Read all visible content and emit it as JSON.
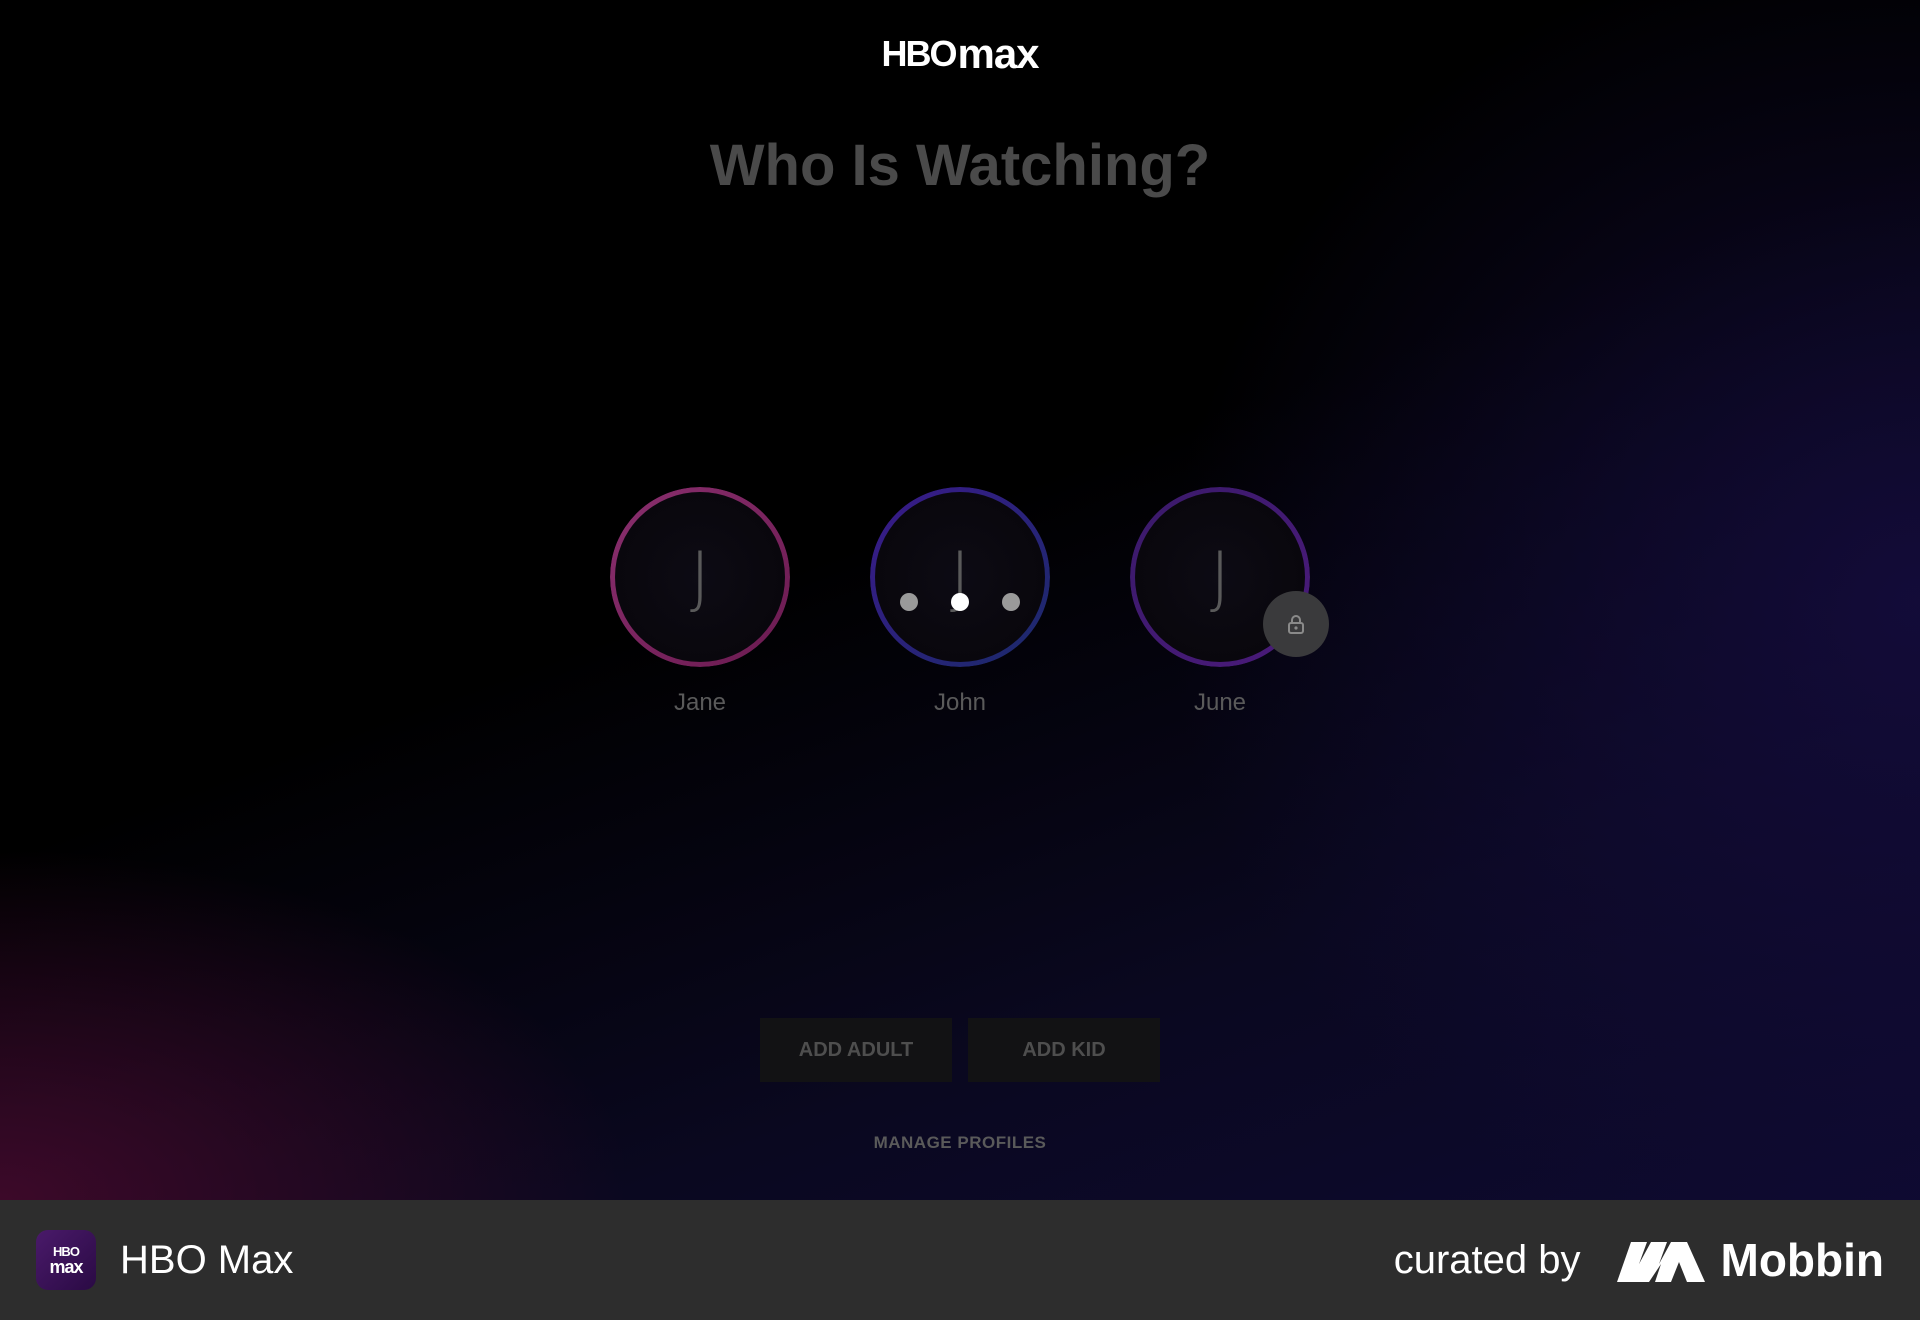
{
  "app": {
    "logo_hbo": "HBO",
    "logo_max": "max"
  },
  "page": {
    "title": "Who Is Watching?"
  },
  "profiles": [
    {
      "initial": "J",
      "name": "Jane",
      "ring_color": "#8a2f6e"
    },
    {
      "initial": "J",
      "name": "John",
      "ring_color": "#3a1a8a",
      "loading": true
    },
    {
      "initial": "J",
      "name": "June",
      "ring_color": "#4a1a7a",
      "locked": true
    }
  ],
  "actions": {
    "add_adult": "ADD ADULT",
    "add_kid": "ADD KID",
    "manage_profiles": "MANAGE PROFILES"
  },
  "footer": {
    "app_icon_line1": "HBO",
    "app_icon_line2": "max",
    "app_name": "HBO Max",
    "curated_by": "curated by",
    "brand": "Mobbin"
  },
  "icons": {
    "lock": "lock-icon",
    "mobbin_logo": "mobbin-logo-icon"
  }
}
